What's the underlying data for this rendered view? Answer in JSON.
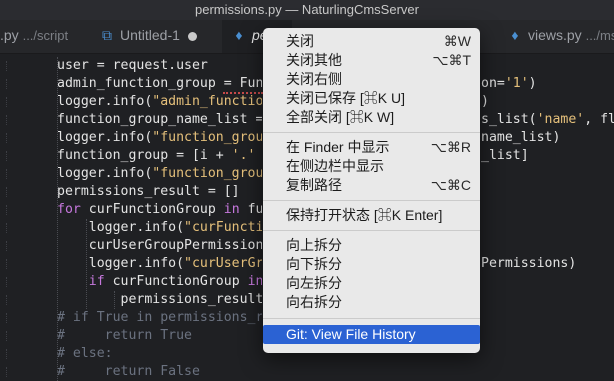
{
  "window": {
    "title": "permissions.py — NaturlingCmsServer"
  },
  "tabs": [
    {
      "icon": "python-icon",
      "name": ".py",
      "path": ".../script"
    },
    {
      "name": "Untitled-1"
    },
    {
      "icon": "python-icon",
      "name": "pe",
      "active": true
    },
    {
      "icon": "python-icon",
      "name": "views.py",
      "path": ".../ms"
    }
  ],
  "editor": {
    "lines": [
      "user = request.user",
      "admin_function_group = Functi",
      "logger.info(\"admin_function_g",
      "function_group_name_list = li",
      "logger.info(\"function_group_n",
      "function_group = [i + '.' + i",
      "logger.info(\"function_group=%",
      "permissions_result = []",
      "for curFunctionGroup in funct",
      "    logger.info(\"curFunctionG",
      "    curUserGroupPermissions =",
      "    logger.info(\"curUserGroup",
      "    if curFunctionGroup in cu",
      "        permissions_result.ap",
      "# if True in permissions_resu",
      "#     return True",
      "# else:",
      "#     return False"
    ],
    "right_fragments": [
      {
        "line": 1,
        "text": "on='1')"
      },
      {
        "line": 2,
        "text": ")"
      },
      {
        "line": 3,
        "text": "s_list('name', flat=True"
      },
      {
        "line": 4,
        "text": "name_list)"
      },
      {
        "line": 5,
        "text": "_list]"
      },
      {
        "line": 11,
        "text": "Permissions)"
      }
    ]
  },
  "context_menu": {
    "items": [
      {
        "label": "关闭",
        "shortcut": "⌘W"
      },
      {
        "label": "关闭其他",
        "shortcut": "⌥⌘T"
      },
      {
        "label": "关闭右侧",
        "shortcut": ""
      },
      {
        "label": "关闭已保存 [⌘K U]",
        "shortcut": ""
      },
      {
        "label": "全部关闭 [⌘K W]",
        "shortcut": ""
      },
      {
        "label": "在 Finder 中显示",
        "shortcut": "⌥⌘R"
      },
      {
        "label": "在侧边栏中显示",
        "shortcut": ""
      },
      {
        "label": "复制路径",
        "shortcut": "⌥⌘C"
      },
      {
        "label": "保持打开状态 [⌘K Enter]",
        "shortcut": ""
      },
      {
        "label": "向上拆分",
        "shortcut": ""
      },
      {
        "label": "向下拆分",
        "shortcut": ""
      },
      {
        "label": "向左拆分",
        "shortcut": ""
      },
      {
        "label": "向右拆分",
        "shortcut": ""
      },
      {
        "label": "Git: View File History",
        "shortcut": "",
        "selected": true
      }
    ]
  },
  "colors": {
    "background": "#1f2023",
    "menu_background": "#e9e9e9",
    "selection": "#2b62d3",
    "string": "#e5c07b",
    "keyword": "#c678dd",
    "comment": "#6b7280"
  }
}
